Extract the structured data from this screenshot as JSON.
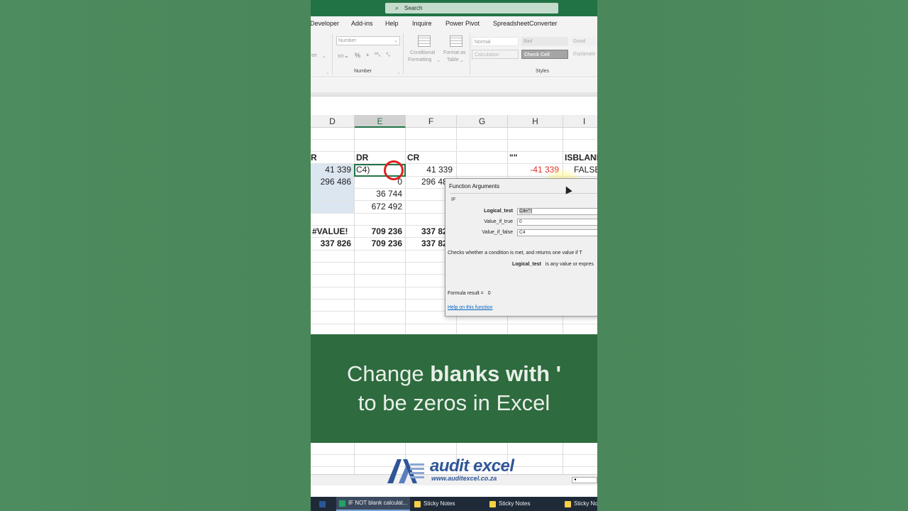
{
  "search": {
    "placeholder": "Search"
  },
  "ribbon_tabs": [
    "Developer",
    "Add-ins",
    "Help",
    "Inquire",
    "Power Pivot",
    "SpreadsheetConverter"
  ],
  "ribbon": {
    "number_format": "Number",
    "number_group_label": "Number",
    "left_dim_label": "ter",
    "conditional_formatting": [
      "Conditional",
      "Formatting"
    ],
    "format_as_table": [
      "Format as",
      "Table"
    ],
    "styles_group_label": "Styles",
    "styles": [
      {
        "name": "Normal",
        "bg": "#ffffff",
        "fg": "#999999"
      },
      {
        "name": "Bad",
        "bg": "#e8e8e8",
        "fg": "#aaaaaa"
      },
      {
        "name": "Good",
        "bg": "#f0f0f0",
        "fg": "#aaaaaa"
      },
      {
        "name": "Calculation",
        "bg": "#f2f2f2",
        "fg": "#b9b9b9"
      },
      {
        "name": "Check Cell",
        "bg": "#a5a5a5",
        "fg": "#f2f2f2"
      },
      {
        "name": "Explanato",
        "bg": "#f3f3f3",
        "fg": "#b0b0b0"
      }
    ]
  },
  "columns": [
    "D",
    "E",
    "F",
    "G",
    "H",
    "I"
  ],
  "selected_column": "E",
  "sheet": {
    "headers": {
      "d": "R",
      "e": "DR",
      "f": "CR",
      "h": "\"\"",
      "i": "ISBLANK"
    },
    "row1": {
      "d": "41 339",
      "e": "C4)",
      "f": "41 339",
      "h": "-41 339",
      "i": "FALSE"
    },
    "row2": {
      "d": "296 486",
      "e": "0",
      "f": "296 48"
    },
    "row3": {
      "e": "36 744"
    },
    "row4": {
      "e": "672 492"
    },
    "totals1": {
      "d": "#VALUE!",
      "e": "709 236",
      "f": "337 82"
    },
    "totals2": {
      "d": "337 826",
      "e": "709 236",
      "f": "337 82"
    },
    "negative_color": "#e0302a"
  },
  "dialog": {
    "title": "Function Arguments",
    "function_name": "IF",
    "args": [
      {
        "label": "Logical_test",
        "value": "C4=\"\""
      },
      {
        "label": "Value_if_true",
        "value": "0"
      },
      {
        "label": "Value_if_false",
        "value": "C4"
      }
    ],
    "description": "Checks whether a condition is met, and returns one value if T",
    "arg_help_label": "Logical_test",
    "arg_help_text": "is any value or expres",
    "formula_result_label": "Formula result =",
    "formula_result_value": "0",
    "help_link": "Help on this function"
  },
  "banner": {
    "line1_normal": "Change ",
    "line1_bold": "blanks with '",
    "line2": "to be zeros in Excel"
  },
  "logo": {
    "word": "audit excel",
    "url": "www.auditexcel.co.za"
  },
  "taskbar": [
    {
      "label": "IF NOT blank calculat...",
      "icon_color": "#21a366"
    },
    {
      "label": "Sticky Notes",
      "icon_color": "#f7d046"
    },
    {
      "label": "Sticky Notes",
      "icon_color": "#f7d046"
    },
    {
      "label": "Sticky No",
      "icon_color": "#f7d046"
    }
  ],
  "colors": {
    "excel_green": "#217346",
    "banner_green": "#2e6b3e",
    "brand_blue": "#2f5597"
  }
}
